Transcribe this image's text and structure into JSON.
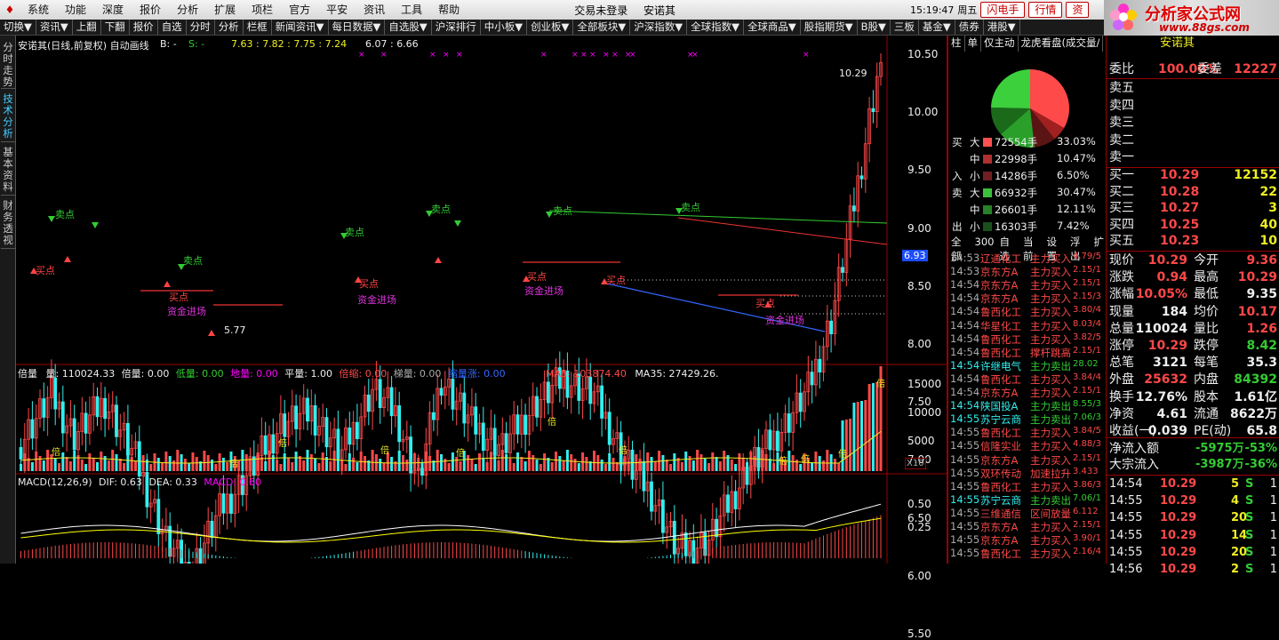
{
  "menu": {
    "items": [
      "系统",
      "功能",
      "深度",
      "报价",
      "分析",
      "扩展",
      "项栏",
      "官方",
      "平安",
      "资讯",
      "工具",
      "帮助"
    ],
    "status": [
      "交易未登录",
      "安诺其"
    ],
    "time": "15:19:47",
    "weekday": "周五",
    "buttons": [
      "闪电手",
      "行情",
      "资"
    ]
  },
  "ad": {
    "title": "分析家公式网",
    "url": "www.88gs.com"
  },
  "toolbar": [
    "切换▼",
    "资讯▼",
    "上翻",
    "下翻",
    "报价",
    "自选",
    "分时",
    "分析",
    "栏框",
    "新闻资讯▼",
    "每日数据▼",
    "自选股▼",
    "沪深排行",
    "中小板▼",
    "创业板▼",
    "全部板块▼",
    "沪深指数▼",
    "全球指数▼",
    "全球商品▼",
    "股指期货▼",
    "B股▼",
    "三板",
    "基金▼",
    "债券",
    "港股▼"
  ],
  "left_tabs": [
    "分时走势",
    "技术分析",
    "基本资料",
    "财务透视"
  ],
  "chart": {
    "title": "安诺其(日线,前复权) 自动画线",
    "b_label": "B: -",
    "s_label": "S: -",
    "ohlc": "7.63 : 7.82 : 7.75 : 7.24",
    "vals2": "6.07 : 6.66",
    "max_label": "10.29",
    "min_label": "5.77",
    "price_marker": "6.93",
    "y_price": [
      "10.50",
      "10.00",
      "9.50",
      "9.00",
      "8.50",
      "8.00",
      "7.50",
      "7.00",
      "6.50",
      "6.00",
      "5.50"
    ],
    "annot": {
      "sell": "卖点",
      "buy": "买点",
      "fund": "资金进场"
    },
    "vol_header": {
      "a": "倍量",
      "b": "量: 110024.33",
      "c": "倍量: 0.00",
      "d": "低量: 0.00",
      "e": "地量: 0.00",
      "f": "平量: 1.00",
      "g": "倍缩: 0.00",
      "h": "梯量: 0.00",
      "i": "缩量涨: 0.00",
      "j": "MA5: 103874.40",
      "k": "MA35: 27429.26."
    },
    "vol_y": [
      "15000",
      "10000",
      "5000"
    ],
    "vol_unit": "X10",
    "vol_bei": "倍",
    "macd_header": {
      "a": "MACD(12,26,9)",
      "b": "DIF: 0.63",
      "c": "DEA: 0.33",
      "d": "MACD: 0.60"
    },
    "macd_y": [
      "0.50",
      "0.25"
    ]
  },
  "stockinfo": {
    "tabs": [
      "柱",
      "单",
      "仅主动",
      "龙虎看盘(成交量/"
    ],
    "flows": [
      {
        "side": "买",
        "size": "大",
        "vol": "72554手",
        "pct": "33.03%",
        "color": "#ff5050"
      },
      {
        "side": "",
        "size": "中",
        "vol": "22998手",
        "pct": "10.47%",
        "color": "#b03030"
      },
      {
        "side": "入",
        "size": "小",
        "vol": "14286手",
        "pct": "6.50%",
        "color": "#702020"
      },
      {
        "side": "卖",
        "size": "大",
        "vol": "66932手",
        "pct": "30.47%",
        "color": "#3cc03c"
      },
      {
        "side": "",
        "size": "中",
        "vol": "26601手",
        "pct": "12.11%",
        "color": "#288028"
      },
      {
        "side": "出",
        "size": "小",
        "vol": "16303手",
        "pct": "7.42%",
        "color": "#1a501a"
      }
    ],
    "tabs2": [
      "全部",
      "300",
      "自选",
      "当前",
      "设置",
      "浮出",
      "扩"
    ],
    "ticks": [
      {
        "t": "14:53",
        "n": "辽通化工",
        "a": "主力买入",
        "v": "4.79/5"
      },
      {
        "t": "14:53",
        "n": "京东方A",
        "a": "主力买入",
        "v": "2.15/1"
      },
      {
        "t": "14:54",
        "n": "京东方A",
        "a": "主力买入",
        "v": "2.15/1"
      },
      {
        "t": "14:54",
        "n": "京东方A",
        "a": "主力买入",
        "v": "2.15/3"
      },
      {
        "t": "14:54",
        "n": "鲁西化工",
        "a": "主力买入",
        "v": "3.80/4"
      },
      {
        "t": "14:54",
        "n": "华星化工",
        "a": "主力买入",
        "v": "8.03/4"
      },
      {
        "t": "14:54",
        "n": "鲁西化工",
        "a": "主力买入",
        "v": "3.82/5"
      },
      {
        "t": "14:54",
        "n": "鲁西化工",
        "a": "撑杆跳高",
        "v": "2.15/1"
      },
      {
        "t": "14:54",
        "n": "许继电气",
        "a": "主力卖出",
        "v": "28.02"
      },
      {
        "t": "14:54",
        "n": "鲁西化工",
        "a": "主力买入",
        "v": "3.84/4"
      },
      {
        "t": "14:54",
        "n": "京东方A",
        "a": "主力买入",
        "v": "2.15/1"
      },
      {
        "t": "14:54",
        "n": "陕国投A",
        "a": "主力卖出",
        "v": "8.55/3"
      },
      {
        "t": "14:55",
        "n": "苏宁云商",
        "a": "主力卖出",
        "v": "7.06/3"
      },
      {
        "t": "14:55",
        "n": "鲁西化工",
        "a": "主力买入",
        "v": "3.84/5"
      },
      {
        "t": "14:55",
        "n": "信隆实业",
        "a": "主力买入",
        "v": "4.88/3"
      },
      {
        "t": "14:55",
        "n": "京东方A",
        "a": "主力买入",
        "v": "2.15/1"
      },
      {
        "t": "14:55",
        "n": "双环传动",
        "a": "加速拉升",
        "v": "3.433"
      },
      {
        "t": "14:55",
        "n": "鲁西化工",
        "a": "主力买入",
        "v": "3.86/3"
      },
      {
        "t": "14:55",
        "n": "苏宁云商",
        "a": "主力卖出",
        "v": "7.06/1"
      },
      {
        "t": "14:55",
        "n": "三维通信",
        "a": "区间放量",
        "v": "6.112"
      },
      {
        "t": "14:55",
        "n": "京东方A",
        "a": "主力买入",
        "v": "2.15/1"
      },
      {
        "t": "14:55",
        "n": "京东方A",
        "a": "主力买入",
        "v": "3.90/1"
      },
      {
        "t": "14:55",
        "n": "鲁西化工",
        "a": "主力买入",
        "v": "2.16/4"
      }
    ]
  },
  "quote": {
    "title": "安诺其",
    "weibi": {
      "l": "委比",
      "v": "100.00%",
      "l2": "委差",
      "v2": "12227"
    },
    "sells": [
      "卖五",
      "卖四",
      "卖三",
      "卖二",
      "卖一"
    ],
    "buys": [
      {
        "l": "买一",
        "p": "10.29",
        "q": "12152"
      },
      {
        "l": "买二",
        "p": "10.28",
        "q": "22"
      },
      {
        "l": "买三",
        "p": "10.27",
        "q": "3"
      },
      {
        "l": "买四",
        "p": "10.25",
        "q": "40"
      },
      {
        "l": "买五",
        "p": "10.23",
        "q": "10"
      }
    ],
    "stats": [
      {
        "l": "现价",
        "v": "10.29",
        "vc": "red",
        "l2": "今开",
        "v2": "9.36",
        "v2c": "red"
      },
      {
        "l": "涨跌",
        "v": "0.94",
        "vc": "red",
        "l2": "最高",
        "v2": "10.29",
        "v2c": "red"
      },
      {
        "l": "涨幅",
        "v": "10.05%",
        "vc": "red",
        "l2": "最低",
        "v2": "9.35",
        "v2c": "wh"
      },
      {
        "l": "现量",
        "v": "184",
        "vc": "wh",
        "l2": "均价",
        "v2": "10.17",
        "v2c": "red"
      },
      {
        "l": "总量",
        "v": "110024",
        "vc": "wh",
        "l2": "量比",
        "v2": "1.26",
        "v2c": "red"
      },
      {
        "l": "涨停",
        "v": "10.29",
        "vc": "red",
        "l2": "跌停",
        "v2": "8.42",
        "v2c": "green"
      },
      {
        "l": "总笔",
        "v": "3121",
        "vc": "wh",
        "l2": "每笔",
        "v2": "35.3",
        "v2c": "wh"
      },
      {
        "l": "外盘",
        "v": "25632",
        "vc": "red",
        "l2": "内盘",
        "v2": "84392",
        "v2c": "green"
      },
      {
        "l": "换手",
        "v": "12.76%",
        "vc": "wh",
        "l2": "股本",
        "v2": "1.61亿",
        "v2c": "wh"
      },
      {
        "l": "净资",
        "v": "4.61",
        "vc": "wh",
        "l2": "流通",
        "v2": "8622万",
        "v2c": "wh"
      },
      {
        "l": "收益(一)",
        "v": "0.039",
        "vc": "wh",
        "l2": "PE(动)",
        "v2": "65.8",
        "v2c": "wh"
      }
    ],
    "flow1": {
      "l": "净流入额",
      "v": "-5975万",
      "p": "-53%"
    },
    "flow2": {
      "l": "大宗流入",
      "v": "-3987万",
      "p": "-36%"
    },
    "trades": [
      {
        "t": "14:54",
        "p": "10.29",
        "q": "5",
        "s": "S",
        "n": "1"
      },
      {
        "t": "14:55",
        "p": "10.29",
        "q": "4",
        "s": "S",
        "n": "1"
      },
      {
        "t": "14:55",
        "p": "10.29",
        "q": "20",
        "s": "S",
        "n": "1"
      },
      {
        "t": "14:55",
        "p": "10.29",
        "q": "14",
        "s": "S",
        "n": "1"
      },
      {
        "t": "14:55",
        "p": "10.29",
        "q": "20",
        "s": "S",
        "n": "1"
      },
      {
        "t": "14:56",
        "p": "10.29",
        "q": "2",
        "s": "S",
        "n": "1"
      }
    ]
  },
  "colors": {
    "up": "#ff4848",
    "down": "#3ee",
    "frame": "#990000",
    "macd_line": "#ffffff",
    "dea_line": "#ffff00"
  }
}
